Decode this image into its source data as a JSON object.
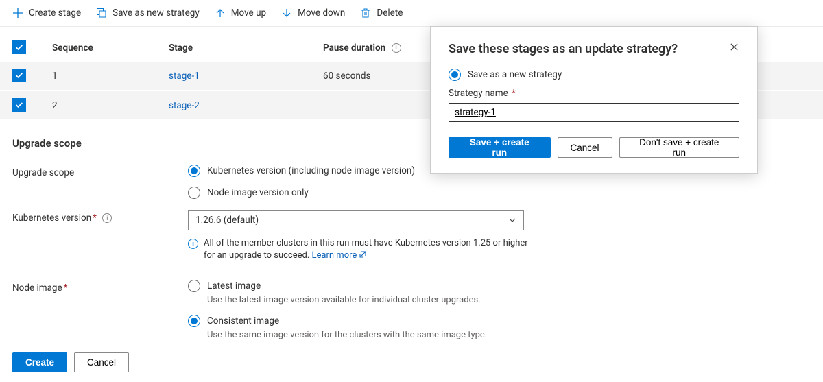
{
  "toolbar": {
    "create_stage": "Create stage",
    "save_strategy": "Save as new strategy",
    "move_up": "Move up",
    "move_down": "Move down",
    "delete": "Delete"
  },
  "table": {
    "headers": {
      "seq": "Sequence",
      "stage": "Stage",
      "pause": "Pause duration"
    },
    "rows": [
      {
        "seq": "1",
        "stage": "stage-1",
        "pause": "60 seconds"
      },
      {
        "seq": "2",
        "stage": "stage-2",
        "pause": ""
      }
    ]
  },
  "section_title": "Upgrade scope",
  "form": {
    "scope_label": "Upgrade scope",
    "scope_opt1": "Kubernetes version (including node image version)",
    "scope_opt2": "Node image version only",
    "k8s_label": "Kubernetes version",
    "k8s_value": "1.26.6 (default)",
    "k8s_info": "All of the member clusters in this run must have Kubernetes version 1.25 or higher for an upgrade to succeed.",
    "learn_more": "Learn more",
    "node_label": "Node image",
    "node_opt1": "Latest image",
    "node_opt1_sub": "Use the latest image version available for individual cluster upgrades.",
    "node_opt2": "Consistent image",
    "node_opt2_sub": "Use the same image version for the clusters with the same image type."
  },
  "footer": {
    "create": "Create",
    "cancel": "Cancel"
  },
  "modal": {
    "title": "Save these stages as an update strategy?",
    "opt_save": "Save as a new strategy",
    "field_label": "Strategy name",
    "value": "strategy-1",
    "btn_save": "Save + create run",
    "btn_cancel": "Cancel",
    "btn_dont": "Don't save + create run"
  }
}
